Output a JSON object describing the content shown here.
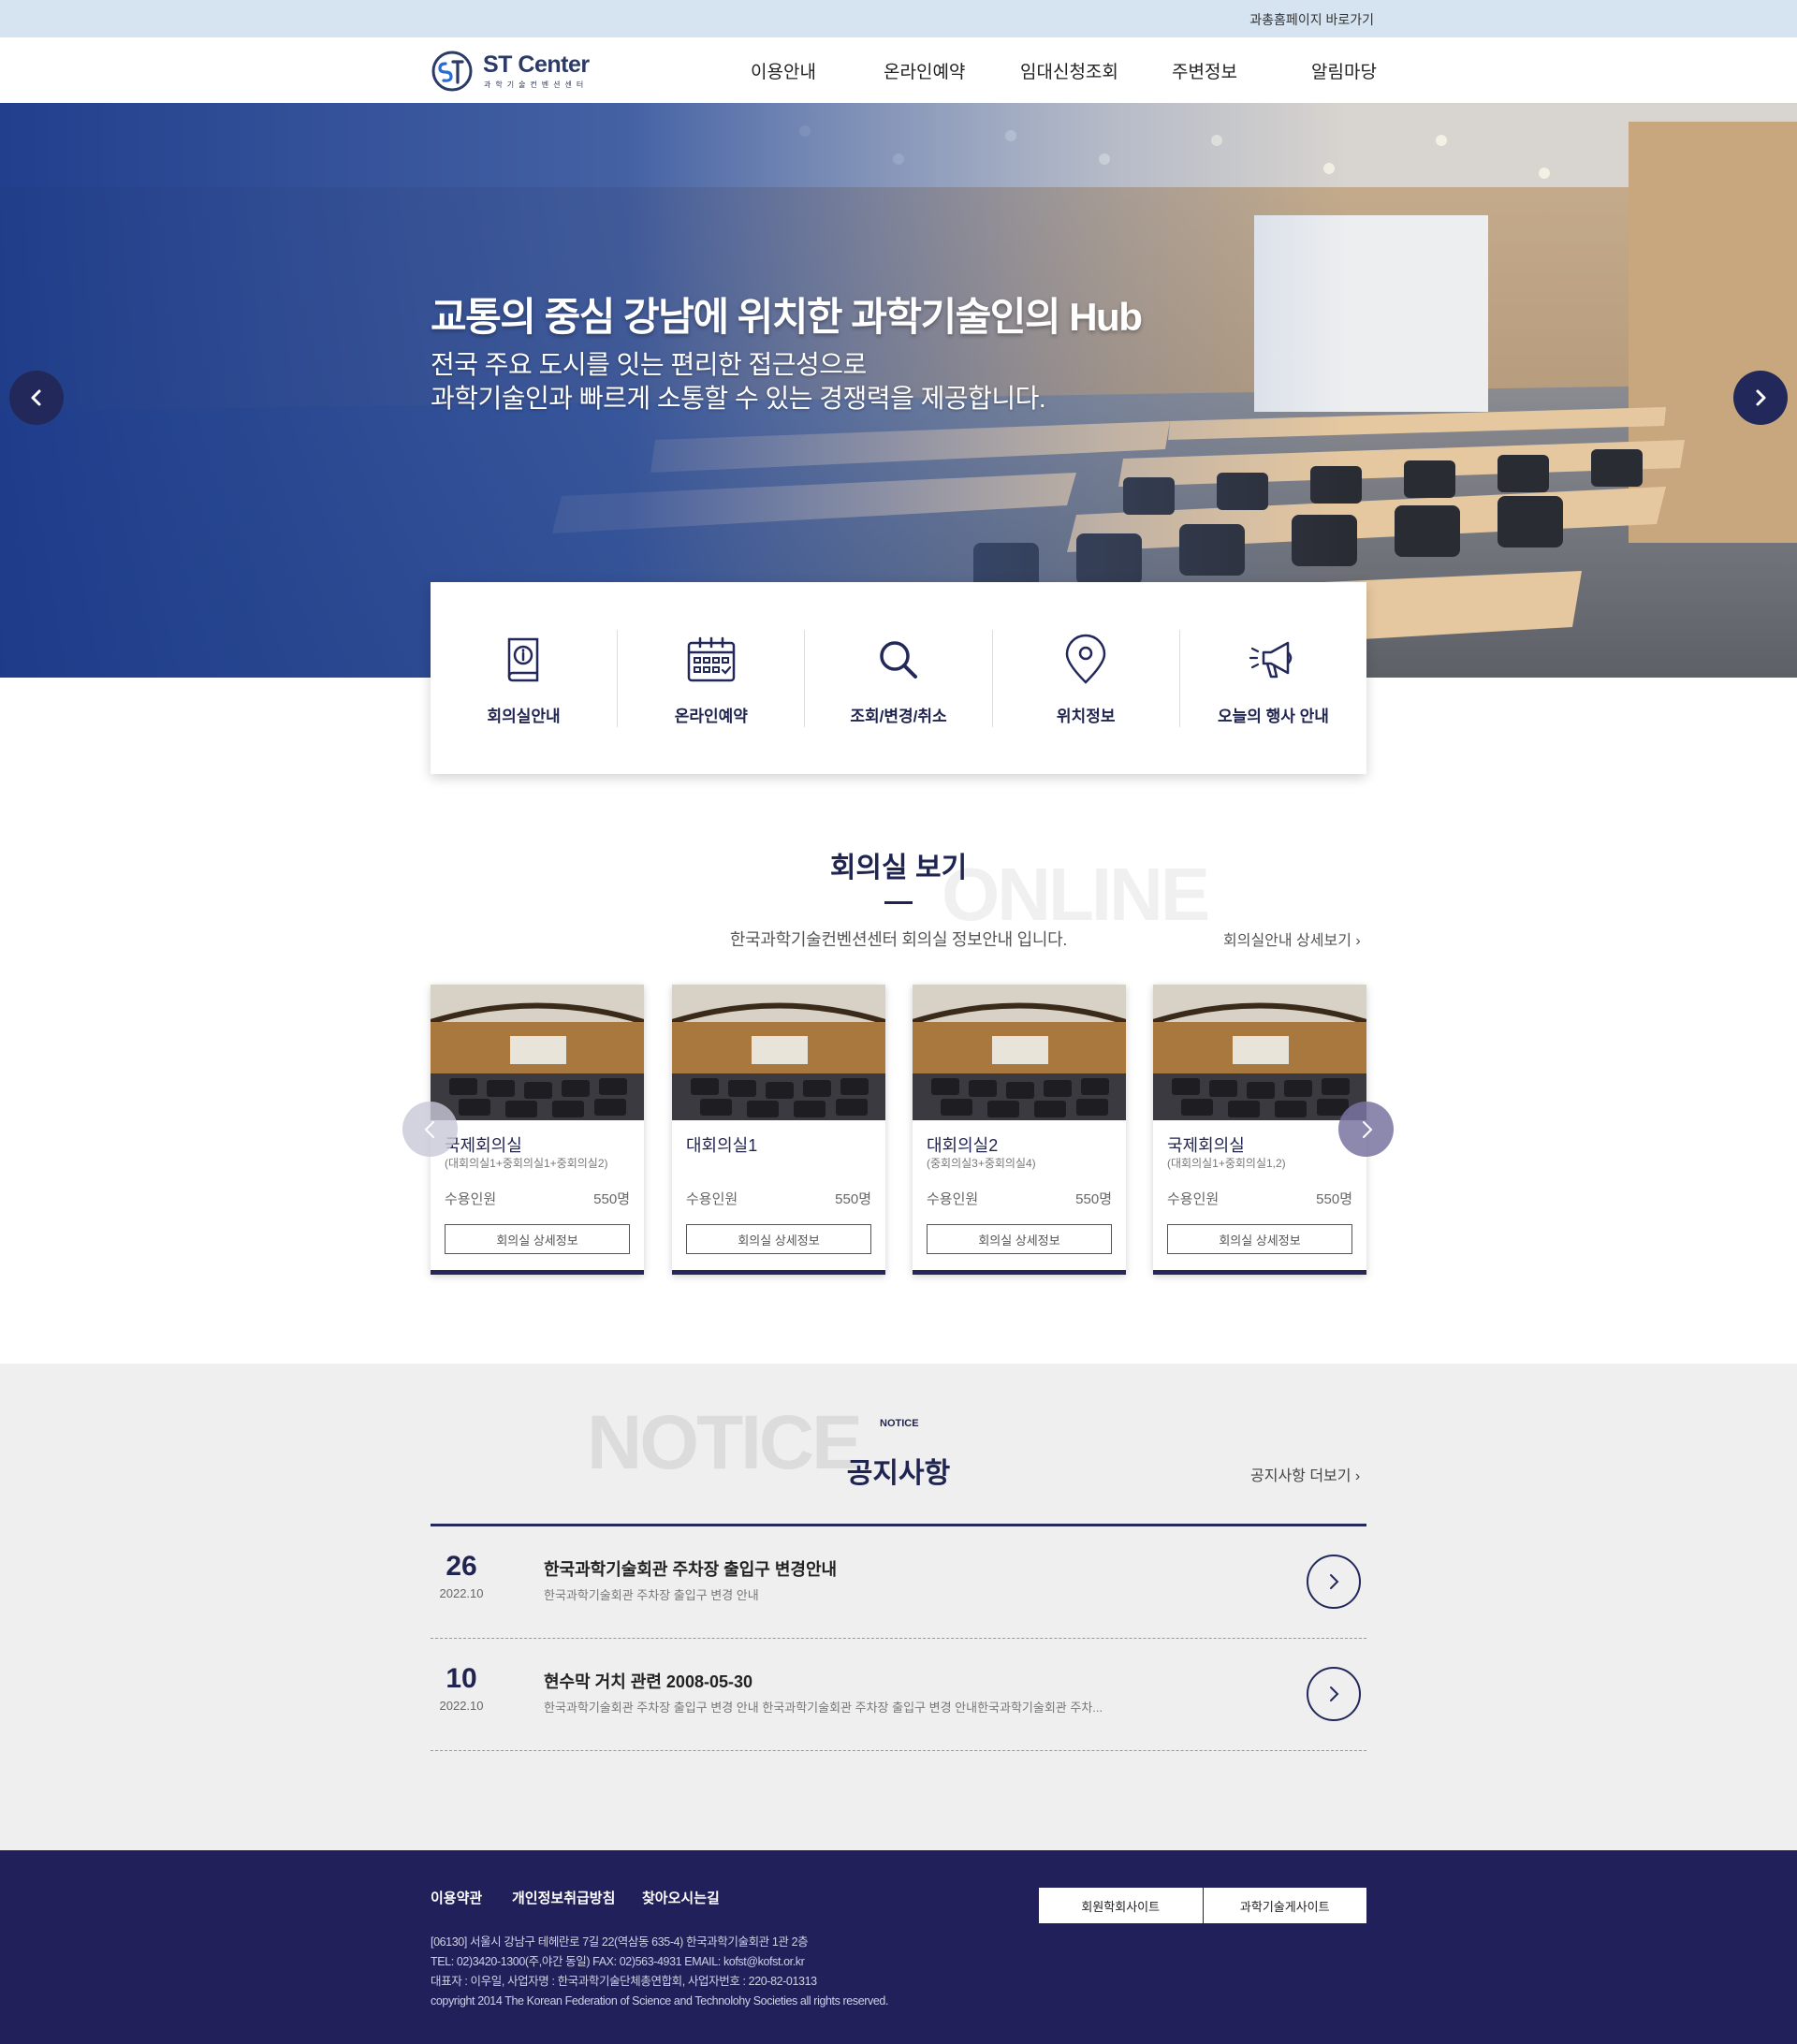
{
  "topbar": {
    "link": "과총홈페이지 바로가기"
  },
  "header": {
    "logo_title": "ST Center",
    "logo_sub": "과학기술컨벤션센터",
    "nav": [
      "이용안내",
      "온라인예약",
      "임대신청조회",
      "주변정보",
      "알림마당"
    ]
  },
  "hero": {
    "title": "교통의 중심 강남에 위치한 과학기술인의 Hub",
    "desc_line1": "전국 주요 도시를 잇는 편리한 접근성으로",
    "desc_line2": "과학기술인과 빠르게 소통할 수 있는 경쟁력을 제공합니다."
  },
  "quick_menu": [
    {
      "label": "회의실안내",
      "icon": "info-book-icon"
    },
    {
      "label": "온라인예약",
      "icon": "calendar-icon"
    },
    {
      "label": "조회/변경/취소",
      "icon": "search-icon"
    },
    {
      "label": "위치정보",
      "icon": "location-pin-icon"
    },
    {
      "label": "오늘의 행사 안내",
      "icon": "megaphone-icon"
    }
  ],
  "rooms": {
    "bg_word": "ONLINE",
    "title": "회의실 보기",
    "subtitle": "한국과학기술컨벤션센터 회의실 정보안내 입니다.",
    "more": "회의실안내 상세보기 ›",
    "cards": [
      {
        "name": "국제회의실",
        "sub": "(대회의실1+중회의실1+중회의실2)",
        "cap_label": "수용인원",
        "cap_value": "550명",
        "button": "회의실 상세정보"
      },
      {
        "name": "대회의실1",
        "sub": "",
        "cap_label": "수용인원",
        "cap_value": "550명",
        "button": "회의실 상세정보"
      },
      {
        "name": "대회의실2",
        "sub": "(중회의실3+중회의실4)",
        "cap_label": "수용인원",
        "cap_value": "550명",
        "button": "회의실 상세정보"
      },
      {
        "name": "국제회의실",
        "sub": "(대회의실1+중회의실1,2)",
        "cap_label": "수용인원",
        "cap_value": "550명",
        "button": "회의실 상세정보"
      }
    ]
  },
  "notice": {
    "bg_word": "NOTICE",
    "small": "NOTICE",
    "title": "공지사항",
    "more": "공지사항 더보기 ›",
    "items": [
      {
        "day": "26",
        "ym": "2022.10",
        "title": "한국과학기술회관 주차장 출입구 변경안내",
        "text": "한국과학기술회관 주차장 출입구 변경 안내"
      },
      {
        "day": "10",
        "ym": "2022.10",
        "title": "현수막 거치 관련 2008-05-30",
        "text": "한국과학기술회관 주차장 출입구 변경 안내 한국과학기술회관 주차장 출입구 변경 안내한국과학기술회관 주차..."
      }
    ]
  },
  "footer": {
    "links": [
      "이용약관",
      "개인정보취급방침",
      "찾아오시는길"
    ],
    "info_line1": "[06130] 서울시 강남구 테헤란로 7길 22(역삼동 635-4) 한국과학기술회관 1관 2층",
    "info_line2": "TEL: 02)3420-1300(주,야간 동일)     FAX: 02)563-4931     EMAIL: kofst@kofst.or.kr",
    "info_line3": "대표자 : 이우일, 사업자명 : 한국과학기술단체총연합회, 사업자번호 : 220-82-01313",
    "info_line4": "copyright 2014 The Korean Federation of Science and Technolohy Societies all rights reserved.",
    "buttons": [
      "회원학회사이트",
      "과학기술게사이트"
    ]
  },
  "colors": {
    "navy": "#22285a",
    "footer": "#22205a",
    "topbar": "#d6e4f2",
    "notice_bg": "#efefef"
  }
}
